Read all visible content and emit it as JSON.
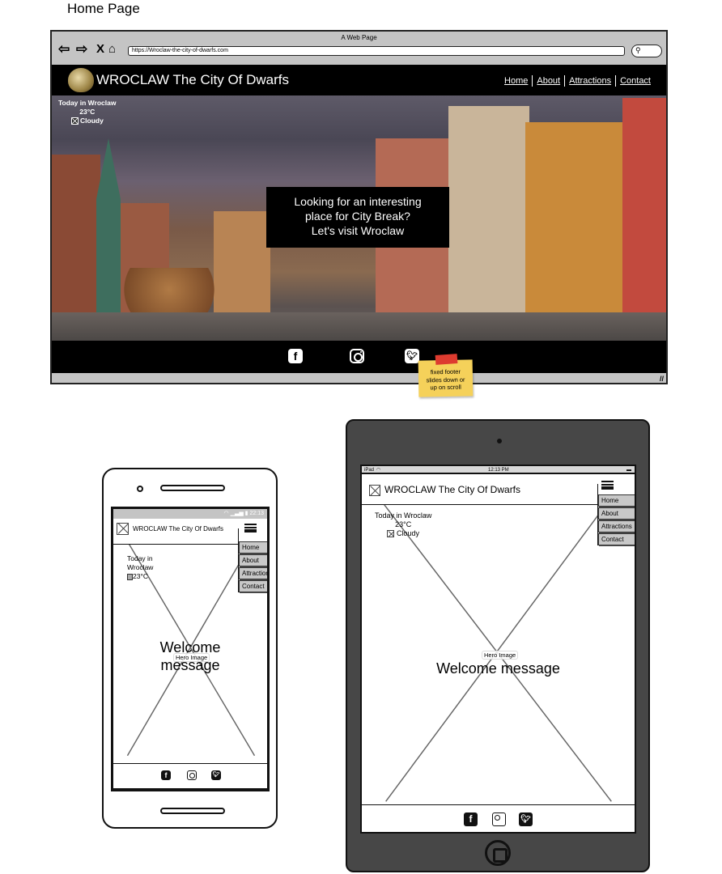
{
  "page_label": "Home Page",
  "desktop": {
    "window_title": "A Web Page",
    "nav_icons": [
      "back-arrow-icon",
      "forward-arrow-icon",
      "close-x-icon",
      "home-icon"
    ],
    "url": "https://Wroclaw-the-city-of-dwarfs.com",
    "site_title": "WROCLAW The City Of Dwarfs",
    "nav": [
      "Home",
      "About",
      "Attractions",
      "Contact"
    ],
    "weather": {
      "heading": "Today in Wroclaw",
      "temp": "23°C",
      "condition": "Cloudy"
    },
    "cta": [
      "Looking for an interesting",
      "place for City Break?",
      "Let's visit Wroclaw"
    ],
    "footer_icons": [
      "facebook-icon",
      "instagram-icon",
      "twitter-icon"
    ],
    "sticky_note": [
      "fixed footer",
      "slides down or",
      "up on scroll"
    ]
  },
  "mobile": {
    "status_time": "22:13",
    "site_title": "WROCLAW The City Of Dwarfs",
    "weather": {
      "line1": "Today in",
      "line2": "Wroclaw",
      "temp": "23°C"
    },
    "menu": [
      "Home",
      "About",
      "Attractions",
      "Contact"
    ],
    "hero_label": "Hero Image",
    "welcome": [
      "Welcome",
      "message"
    ]
  },
  "tablet": {
    "status_left": "iPad",
    "status_time": "12:13 PM",
    "site_title": "WROCLAW The City Of Dwarfs",
    "weather": {
      "heading": "Today in Wroclaw",
      "temp": "23°C",
      "condition": "Cloudy"
    },
    "menu": [
      "Home",
      "About",
      "Attractions",
      "Contact"
    ],
    "hero_label": "Hero Image",
    "welcome": "Welcome message"
  },
  "colors": {
    "header_bg": "#000000",
    "chrome": "#c4c4c4",
    "sticky": "#f5d15a",
    "tape": "#dd3b2f",
    "tablet_body": "#474747"
  }
}
